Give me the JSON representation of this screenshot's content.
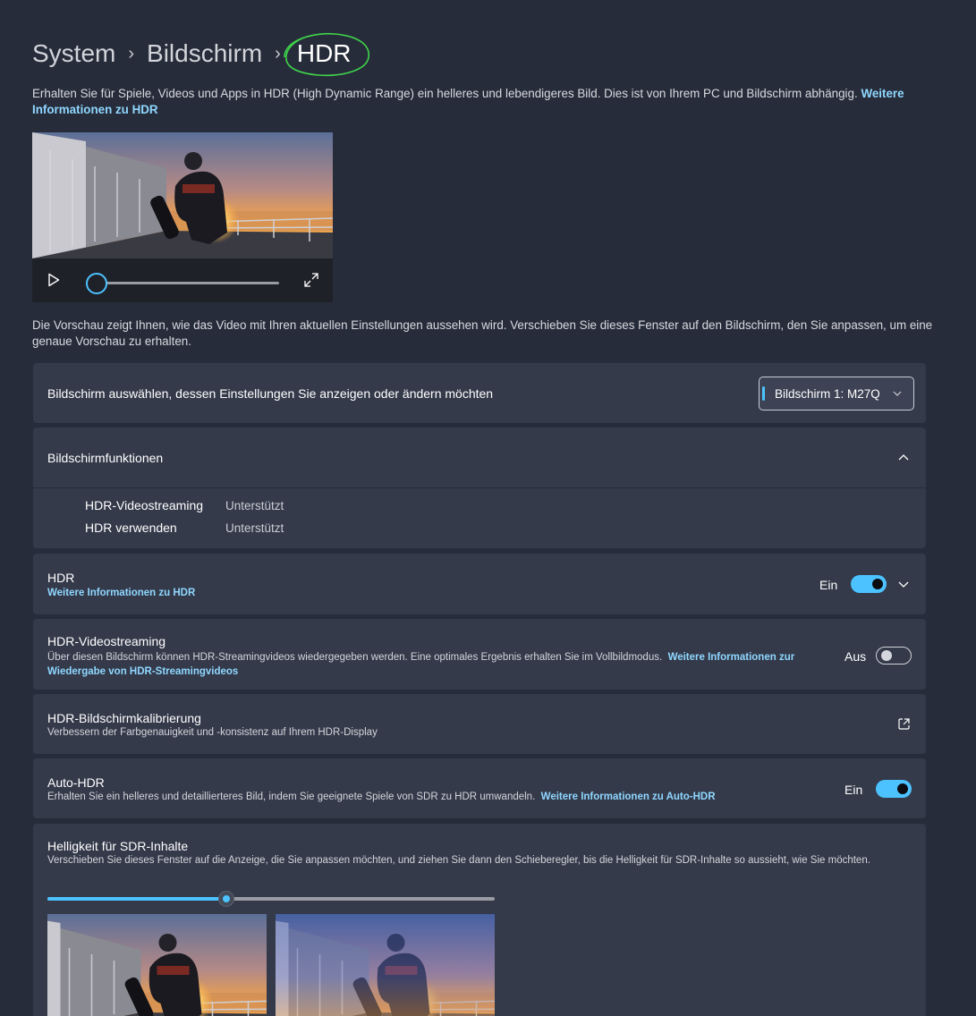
{
  "breadcrumb": {
    "parent1": "System",
    "parent2": "Bildschirm",
    "current": "HDR",
    "sep": "›"
  },
  "intro": {
    "text": "Erhalten Sie für Spiele, Videos und Apps in HDR (High Dynamic Range) ein helleres und lebendigeres Bild. Dies ist von Ihrem PC und Bildschirm abhängig.",
    "link": "Weitere Informationen zu HDR"
  },
  "video": {
    "progress": 0
  },
  "preview_text": "Die Vorschau zeigt Ihnen, wie das Video mit Ihren aktuellen Einstellungen aussehen wird. Verschieben Sie dieses Fenster auf den Bildschirm, den Sie anpassen, um eine genaue Vorschau zu erhalten.",
  "select_display": {
    "label": "Bildschirm auswählen, dessen Einstellungen Sie anzeigen oder ändern möchten",
    "value": "Bildschirm 1: M27Q"
  },
  "capabilities": {
    "title": "Bildschirmfunktionen",
    "rows": [
      {
        "name": "HDR-Videostreaming",
        "value": "Unterstützt"
      },
      {
        "name": "HDR verwenden",
        "value": "Unterstützt"
      }
    ]
  },
  "hdr": {
    "title": "HDR",
    "link": "Weitere Informationen zu HDR",
    "state": "Ein",
    "on": true
  },
  "streaming": {
    "title": "HDR-Videostreaming",
    "desc": "Über diesen Bildschirm können HDR-Streamingvideos wiedergegeben werden. Eine optimales Ergebnis erhalten Sie im Vollbildmodus.",
    "link": "Weitere Informationen zur Wiedergabe von HDR-Streamingvideos",
    "state": "Aus",
    "on": false
  },
  "calibration": {
    "title": "HDR-Bildschirmkalibrierung",
    "desc": "Verbessern der Farbgenauigkeit und -konsistenz auf Ihrem HDR-Display"
  },
  "autohdr": {
    "title": "Auto-HDR",
    "desc": "Erhalten Sie ein helleres und detaillierteres Bild, indem Sie geeignete Spiele von SDR zu HDR umwandeln.",
    "link": "Weitere Informationen zu Auto-HDR",
    "state": "Ein",
    "on": true
  },
  "sdr": {
    "title": "Helligkeit für SDR-Inhalte",
    "desc": "Verschieben Sie dieses Fenster auf die Anzeige, die Sie anpassen möchten, und ziehen Sie dann den Schieberegler, bis die Helligkeit für SDR-Inhalte so aussieht, wie Sie möchten.",
    "slider_fraction": 0.4
  },
  "colors": {
    "accent": "#4cc2ff",
    "link": "#8fd7ff",
    "card": "#343a4a",
    "background": "#272c3a",
    "annotation": "#3fd44a"
  }
}
